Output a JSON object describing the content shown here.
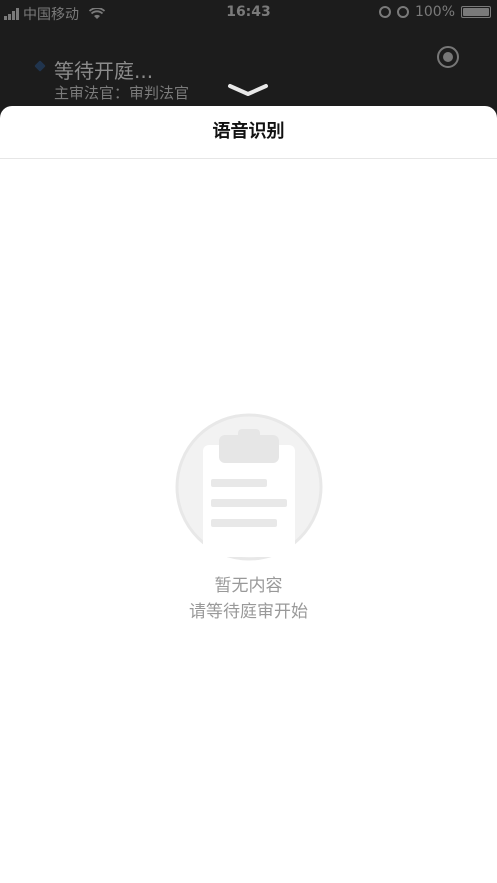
{
  "status_bar": {
    "carrier": "中国移动",
    "time": "16:43",
    "battery_text": "100%",
    "battery_level": 1.0
  },
  "background": {
    "session_status": "等待开庭...",
    "judge_line": "主审法官：审判法官"
  },
  "sheet": {
    "title": "语音识别",
    "empty_title": "暂无内容",
    "empty_subtitle": "请等待庭审开始"
  },
  "icons": {
    "record": "record-icon",
    "collapse": "chevron-down-icon",
    "empty": "clipboard-icon"
  }
}
